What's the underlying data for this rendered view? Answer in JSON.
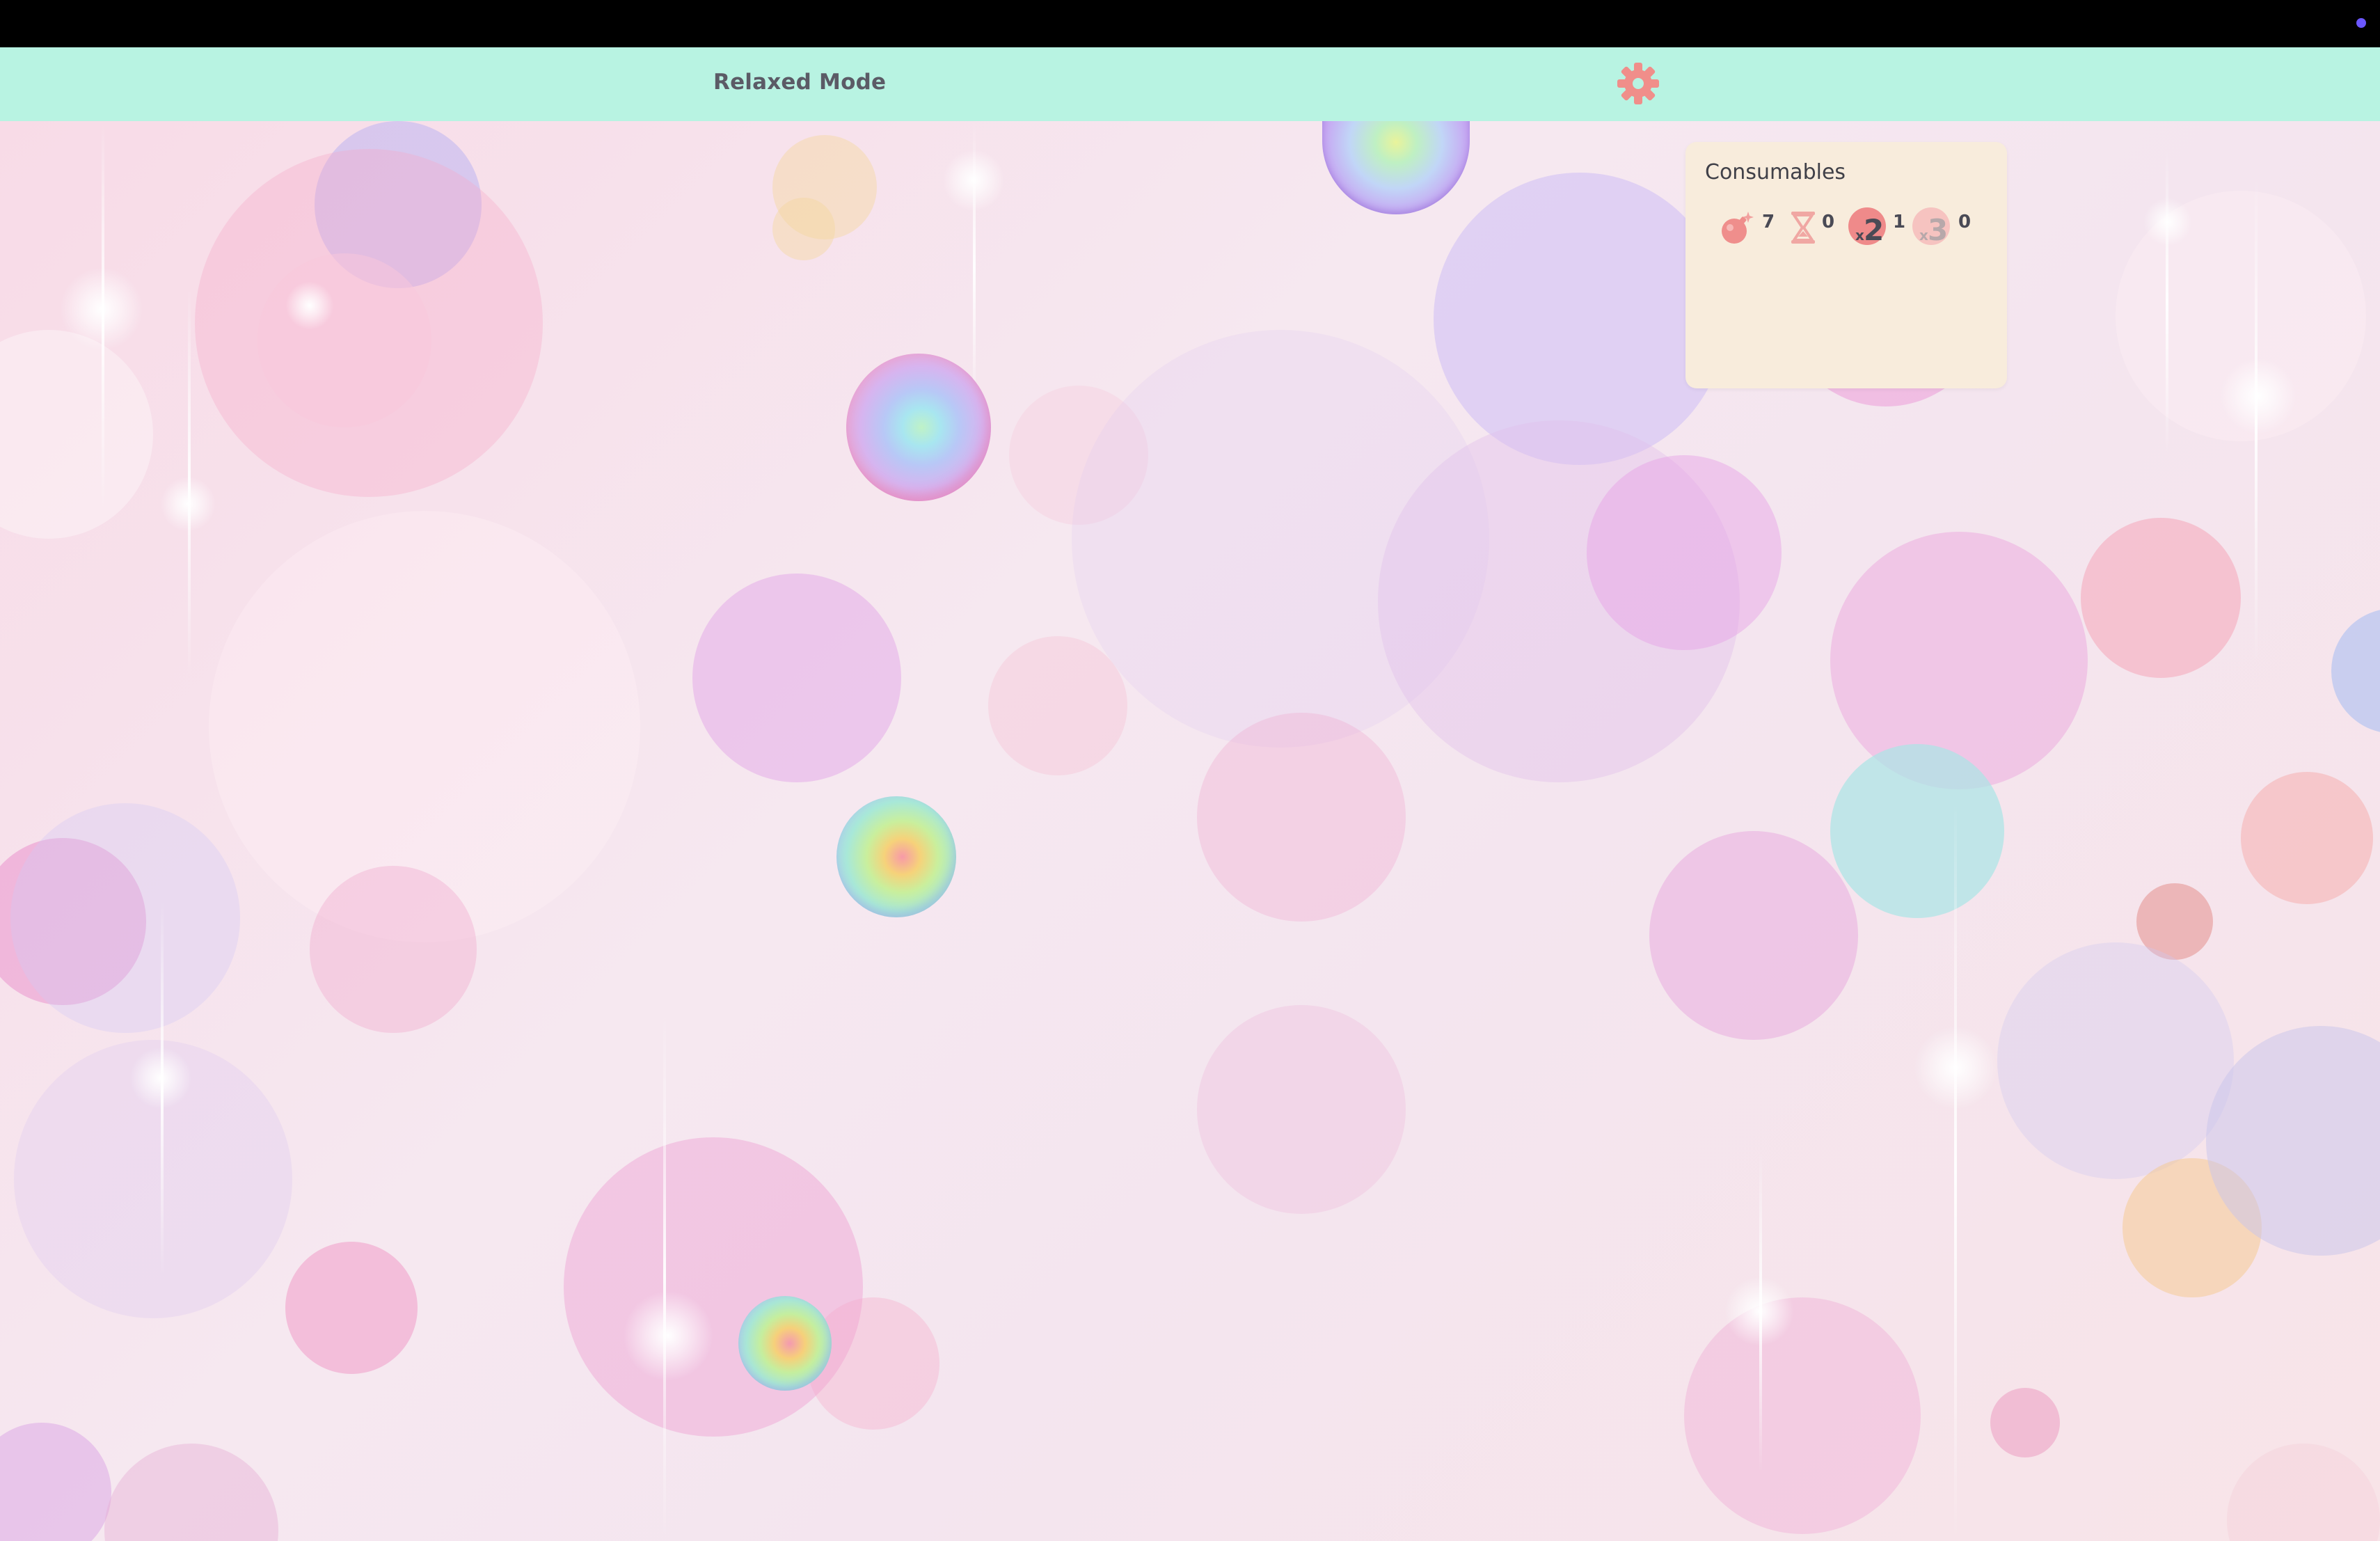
{
  "header": {
    "mode_title": "Relaxed Mode",
    "settings_icon": "gear-icon",
    "accent_color": "#b8f3e2",
    "gear_color": "#f08e8a"
  },
  "consumables": {
    "title": "Consumables",
    "items": [
      {
        "icon": "bomb-icon",
        "count": "7"
      },
      {
        "icon": "hourglass-icon",
        "count": "0"
      },
      {
        "icon": "x2-multiplier-icon",
        "multiplier": "2",
        "count": "1"
      },
      {
        "icon": "x3-multiplier-icon",
        "multiplier": "3",
        "count": "0"
      }
    ]
  },
  "playfield": {
    "bubbles": [
      {
        "name": "bubble-1"
      },
      {
        "name": "bubble-2"
      },
      {
        "name": "bubble-3"
      },
      {
        "name": "bubble-4"
      }
    ]
  }
}
